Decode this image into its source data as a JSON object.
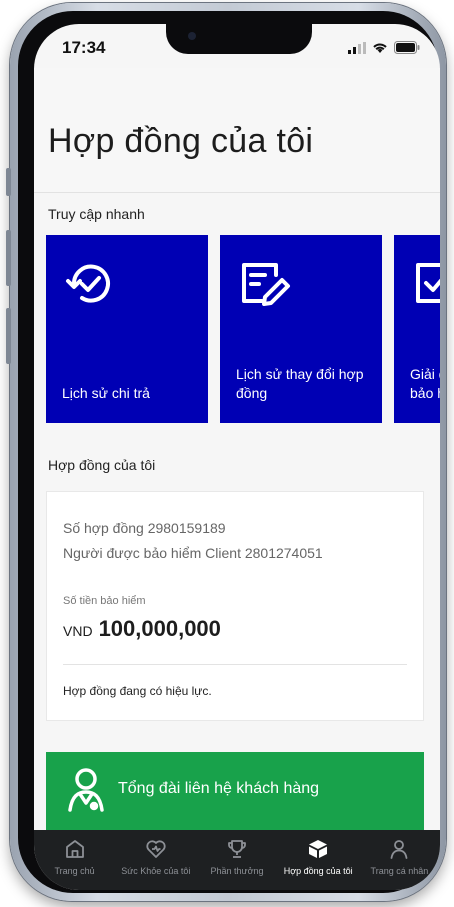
{
  "status_bar": {
    "time": "17:34"
  },
  "header": {
    "title": "Hợp đồng của tôi"
  },
  "quick_access": {
    "title": "Truy cập nhanh",
    "cards": [
      {
        "label": "Lịch sử chi trả",
        "icon": "payment-history-icon"
      },
      {
        "label": "Lịch sử thay đổi hợp đồng",
        "icon": "edit-document-icon"
      },
      {
        "label": "Giải quyết quyền lợi bảo hiểm",
        "icon": "claim-document-icon"
      }
    ]
  },
  "contracts": {
    "title": "Hợp đồng của tôi",
    "contract_number": "Số hợp đồng 2980159189",
    "insured": "Người được bảo hiểm Client 2801274051",
    "sum_label": "Số tiền bảo hiểm",
    "currency": "VND",
    "amount": "100,000,000",
    "status": "Hợp đồng đang có hiệu lực."
  },
  "hotline": {
    "label": "Tổng đài liên hệ khách hàng"
  },
  "tabbar": {
    "tabs": [
      {
        "label": "Trang chủ",
        "icon": "home-icon",
        "active": false
      },
      {
        "label": "Sức Khỏe của tôi",
        "icon": "health-heart-icon",
        "active": false
      },
      {
        "label": "Phần thưởng",
        "icon": "trophy-icon",
        "active": false
      },
      {
        "label": "Hợp đồng của tôi",
        "icon": "contract-box-icon",
        "active": true
      },
      {
        "label": "Trang cá nhân",
        "icon": "profile-icon",
        "active": false
      }
    ]
  },
  "colors": {
    "card_blue": "#0000b4",
    "hotline_green": "#18a24b",
    "tabbar_bg": "#1e2022"
  }
}
